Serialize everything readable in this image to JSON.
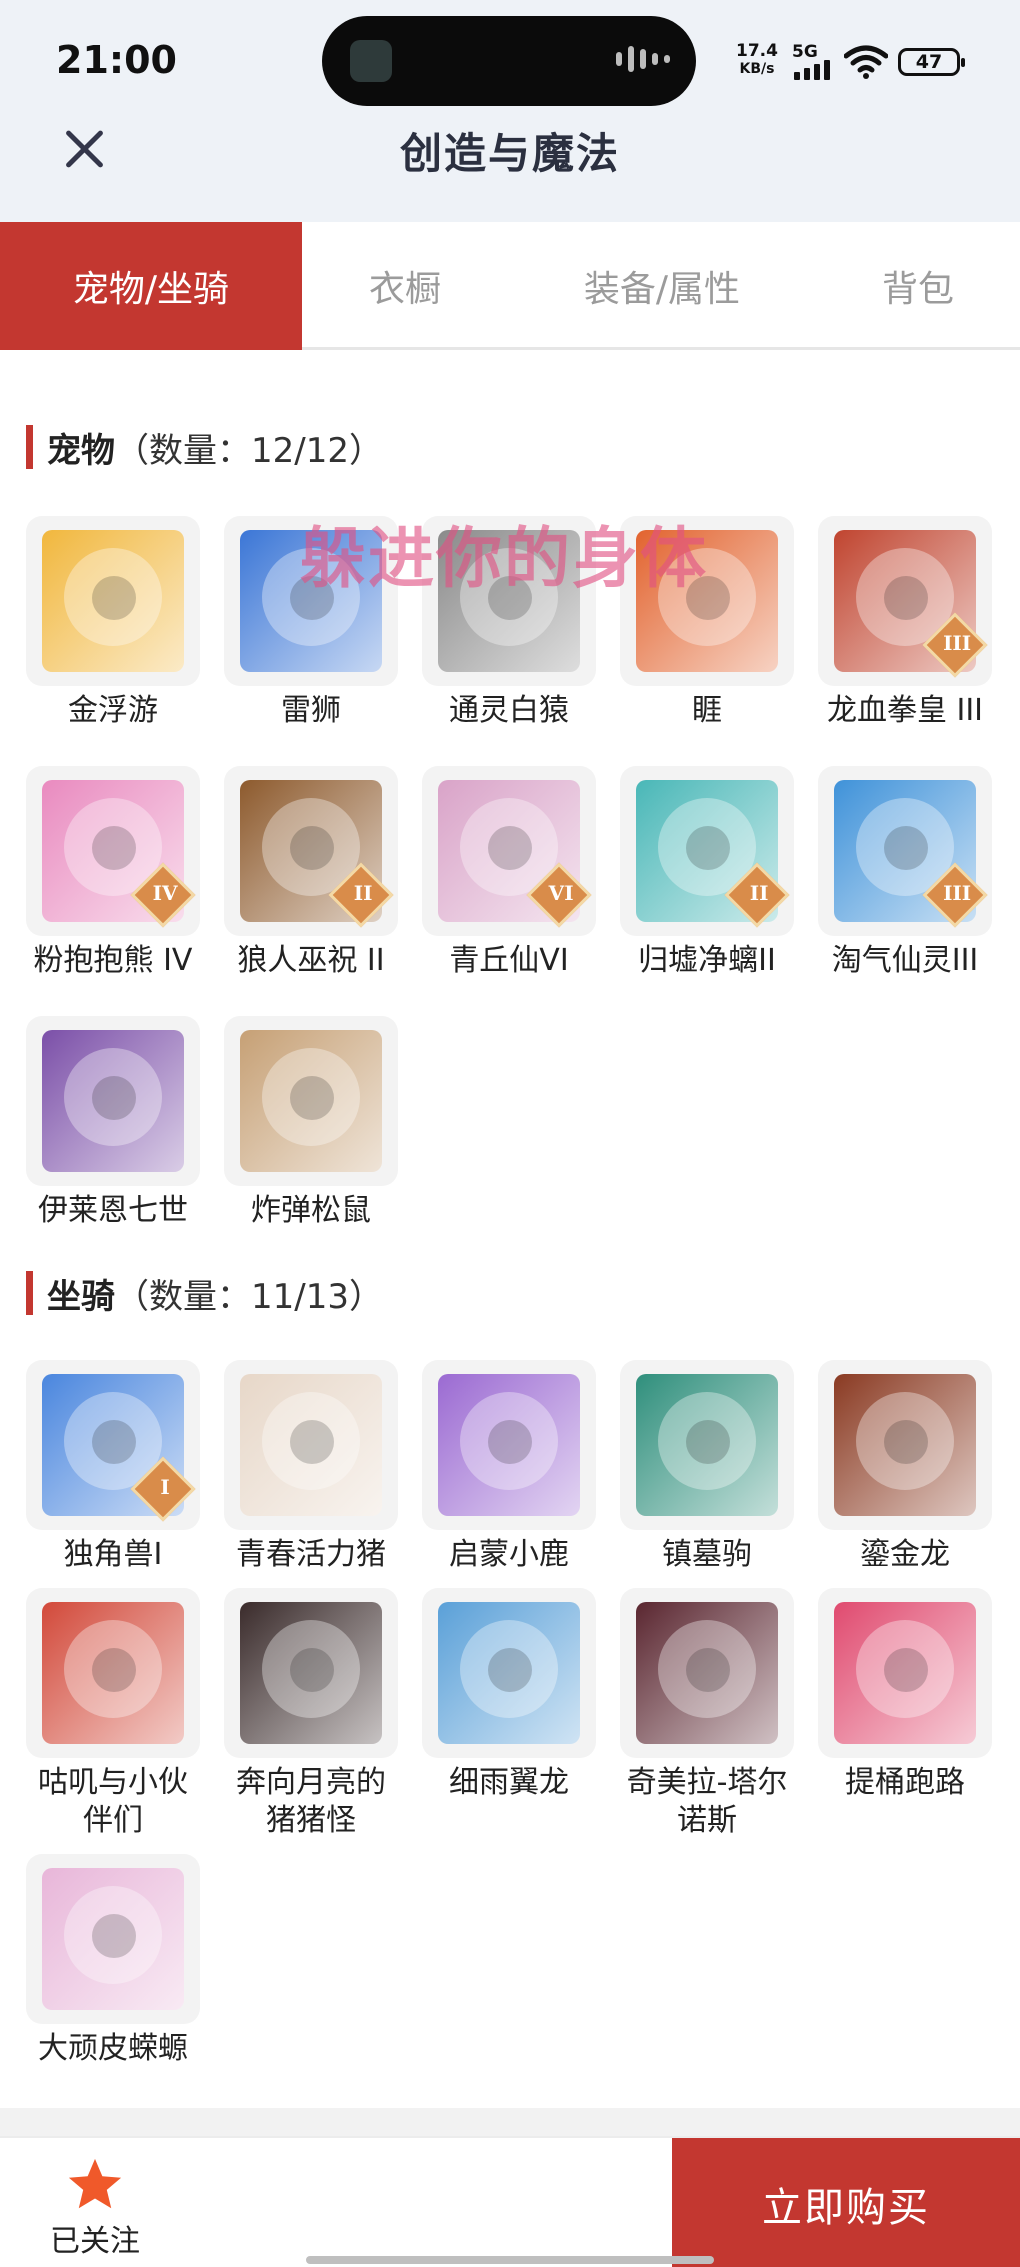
{
  "status_bar": {
    "time": "21:00",
    "net_speed": "17.4",
    "net_unit": "KB/s",
    "network": "5G",
    "battery": "47"
  },
  "header": {
    "close_icon": "close-icon",
    "title": "创造与魔法"
  },
  "tabs": [
    {
      "label": "宠物/坐骑",
      "active": true
    },
    {
      "label": "衣橱",
      "active": false
    },
    {
      "label": "装备/属性",
      "active": false
    },
    {
      "label": "背包",
      "active": false
    }
  ],
  "pets": {
    "title": "宠物",
    "count": "（数量：12/12）",
    "items": [
      {
        "name": "金浮游",
        "color": "#f1b73d"
      },
      {
        "name": "雷狮",
        "color": "#3b76d6"
      },
      {
        "name": "通灵白猿",
        "color": "#8a8a8a"
      },
      {
        "name": "睚",
        "color": "#e2632e"
      },
      {
        "name": "龙血拳皇 III",
        "color": "#c0442f",
        "rank": "III"
      },
      {
        "name": "粉抱抱熊 IV",
        "color": "#e98abf",
        "rank": "IV"
      },
      {
        "name": "狼人巫祝 II",
        "color": "#8d5a2d",
        "rank": "II"
      },
      {
        "name": "青丘仙VI",
        "color": "#d9a3c8",
        "rank": "VI"
      },
      {
        "name": "归墟净螭II",
        "color": "#49b7b7",
        "rank": "II"
      },
      {
        "name": "淘气仙灵III",
        "color": "#3f92d9",
        "rank": "III"
      },
      {
        "name": "伊莱恩七世",
        "color": "#7b4fa8"
      },
      {
        "name": "炸弹松鼠",
        "color": "#c6a075"
      }
    ]
  },
  "mounts": {
    "title": "坐骑",
    "count": "（数量：11/13）",
    "items": [
      {
        "name": "独角兽I",
        "color": "#4a86de",
        "rank": "I"
      },
      {
        "name": "青春活力猪",
        "color": "#e7d7c8"
      },
      {
        "name": "启蒙小鹿",
        "color": "#9b6ad2"
      },
      {
        "name": "镇墓驹",
        "color": "#2f8f7c"
      },
      {
        "name": "鎏金龙",
        "color": "#8a3a22"
      },
      {
        "name": "咕叽与小伙伴们",
        "color": "#d2493a"
      },
      {
        "name": "奔向月亮的猪猪怪",
        "color": "#3a2b2b"
      },
      {
        "name": "细雨翼龙",
        "color": "#5aa0d8"
      },
      {
        "name": "奇美拉-塔尔诺斯",
        "color": "#5a2630"
      },
      {
        "name": "提桶跑路",
        "color": "#e04a6f"
      },
      {
        "name": "大顽皮蝾螈",
        "color": "#e8b6d9"
      }
    ]
  },
  "watermark": "躲进你的身体",
  "bottom_bar": {
    "follow_icon": "star-icon",
    "follow_label": "已关注",
    "buy_label": "立即购买",
    "accent_color": "#c33730",
    "star_color": "#f0592a"
  }
}
